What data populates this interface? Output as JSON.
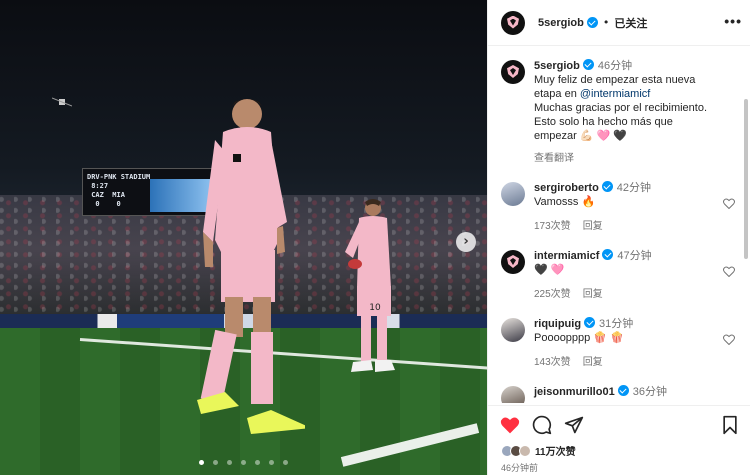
{
  "post": {
    "username": "5sergiob",
    "follow_status": "已关注",
    "separator": "•",
    "caption_time": "46分钟",
    "caption_text_1": "Muy feliz de empezar esta nueva\netapa en ",
    "caption_mention": "@intermiamicf",
    "caption_text_2": "Muchas gracias por el recibimiento.\nEsto solo ha hecho más que\nempezar 💪🏻 🩷 🖤",
    "see_translation": "查看翻译",
    "likes": "11万次赞",
    "post_time": "46分钟前",
    "more_label": "•••",
    "image_count": 7,
    "image_index": 1
  },
  "photo": {
    "scoreboard_text": "DRV-PNK STADIUM\n 8:27\n CAZ  MIA\n  0    0"
  },
  "comments": [
    {
      "username": "sergiroberto",
      "time": "42分钟",
      "text": "Vamosss 🔥",
      "likes": "173次赞",
      "reply": "回复"
    },
    {
      "username": "intermiamicf",
      "time": "47分钟",
      "text": "🖤 🩷",
      "likes": "225次赞",
      "reply": "回复"
    },
    {
      "username": "riquipuig",
      "time": "31分钟",
      "text": "Poooopppp 🍿 🍿",
      "likes": "143次赞",
      "reply": "回复"
    },
    {
      "username": "jeisonmurillo01",
      "time": "36分钟",
      "text": "",
      "likes": "",
      "reply": ""
    }
  ],
  "icons": {
    "like": "heart-filled-icon",
    "comment": "comment-icon",
    "share": "paper-plane-icon",
    "save": "bookmark-icon",
    "next": "chevron-right-icon",
    "more": "more-dots-icon",
    "verified": "verified-badge-icon"
  },
  "colors": {
    "like_red": "#ff3040",
    "verified_blue": "#0095f6",
    "muted_text": "#737373",
    "mention": "#00376b",
    "jersey_pink": "#f3b8c8"
  }
}
